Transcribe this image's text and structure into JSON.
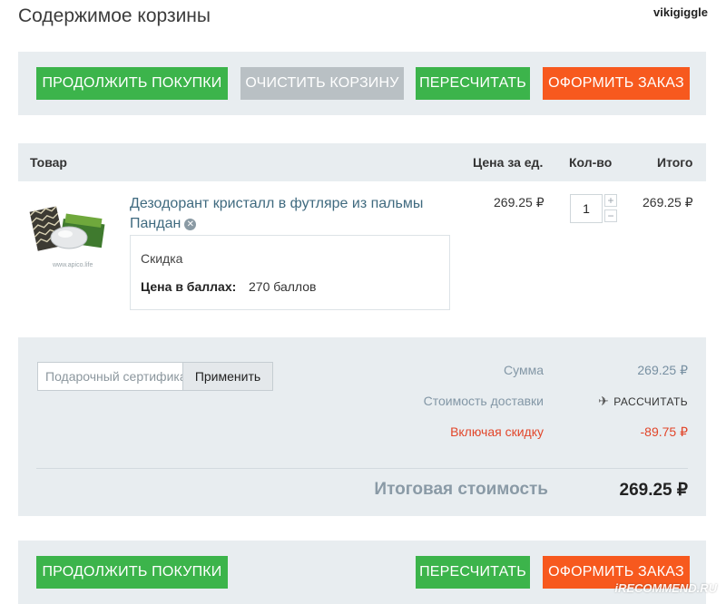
{
  "header": {
    "title": "Содержимое корзины",
    "username": "vikigiggle"
  },
  "buttons": {
    "continue": "ПРОДОЛЖИТЬ ПОКУПКИ",
    "clear": "ОЧИСТИТЬ КОРЗИНУ",
    "recalculate": "ПЕРЕСЧИТАТЬ",
    "checkout": "ОФОРМИТЬ ЗАКАЗ"
  },
  "colors": {
    "green": "#3cb44b",
    "grey": "#b9c0c4",
    "orange": "#f7591e",
    "panel": "#e8edf0",
    "link": "#3f6a7f",
    "discount": "#e2462a"
  },
  "table": {
    "columns": [
      "Товар",
      "Цена за ед.",
      "Кол-во",
      "Итого"
    ],
    "rows": [
      {
        "name": "Дезодорант кристалл в футляре из пальмы Пандан",
        "thumb_caption": "www.apico.life",
        "discount_label": "Скидка",
        "points_label": "Цена в баллах:",
        "points_value": "270 баллов",
        "unit_price": "269.25 ₽",
        "quantity": "1",
        "total": "269.25 ₽"
      }
    ]
  },
  "icons": {
    "remove": "close-circle-icon",
    "plus": "plus-icon",
    "minus": "minus-icon",
    "delivery": "airplane-icon"
  },
  "summary": {
    "coupon_placeholder": "Подарочный сертификат",
    "apply_label": "Применить",
    "sum_label": "Сумма",
    "sum_value": "269.25 ₽",
    "delivery_label": "Стоимость доставки",
    "delivery_action": "РАССЧИТАТЬ",
    "discount_label": "Включая скидку",
    "discount_value": "-89.75 ₽",
    "total_label": "Итоговая стоимость",
    "total_value": "269.25 ₽"
  },
  "watermark": "iRECOMMEND.RU"
}
